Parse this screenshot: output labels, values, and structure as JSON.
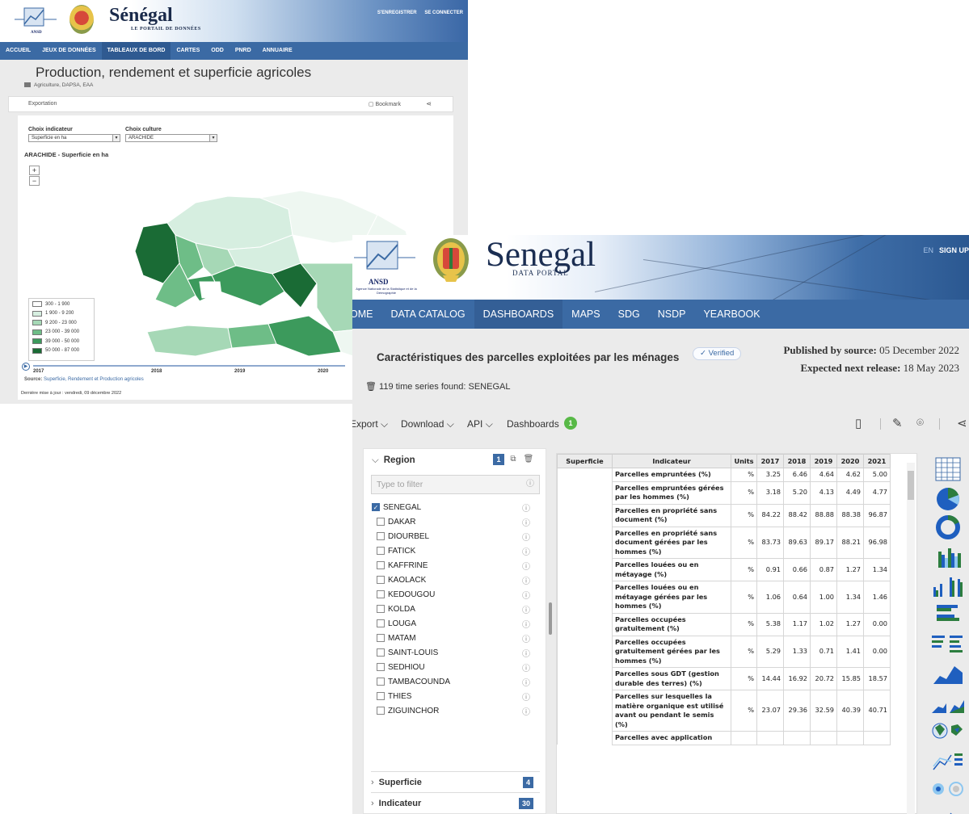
{
  "back_window": {
    "brand": "Sénégal",
    "brand_sub": "LE PORTAIL DE DONNÉES",
    "auth": [
      "S'ENREGISTRER",
      "SE CONNECTER"
    ],
    "nav": [
      "ACCUEIL",
      "JEUX DE DONNÉES",
      "TABLEAUX DE BORD",
      "CARTES",
      "ODD",
      "PNRD",
      "ANNUAIRE"
    ],
    "active_nav": "TABLEAUX DE BORD",
    "title": "Production, rendement et superficie agricoles",
    "breadcrumb": "Agriculture, DAPSA, EAA",
    "export_label": "Exportation",
    "bookmark_label": "Bookmark",
    "indicator_label": "Choix indicateur",
    "indicator_value": "Superficie en ha",
    "culture_label": "Choix culture",
    "culture_value": "ARACHIDE",
    "map_title": "ARACHIDE - Superficie en ha",
    "zoom_in": "+",
    "zoom_out": "−",
    "legend": [
      {
        "label": "300 - 1 900",
        "color": "#ffffff"
      },
      {
        "label": "1 900 - 9 200",
        "color": "#d6eee0"
      },
      {
        "label": "9 200 - 23 000",
        "color": "#a6d8b6"
      },
      {
        "label": "23 000 - 39 000",
        "color": "#6ebd87"
      },
      {
        "label": "39 000 - 50 000",
        "color": "#3c9a5c"
      },
      {
        "label": "50 000 - 87 000",
        "color": "#1a6b35"
      }
    ],
    "timeline_years": [
      "2017",
      "2018",
      "2019",
      "2020"
    ],
    "source_prefix": "Source:",
    "source_link": "Superficie, Rendement et Production agricoles",
    "updated": "Dernière mise à jour : vendredi, 09 décembre 2022"
  },
  "front_window": {
    "ansd": "ANSD",
    "ansd_sub": "Agence Nationale de la Statistique et de la Démographie",
    "brand": "Senegal",
    "brand_sub": "DATA PORTAL",
    "lang": "EN",
    "signup": "SIGN UP",
    "nav": [
      "OME",
      "DATA CATALOG",
      "DASHBOARDS",
      "MAPS",
      "SDG",
      "NSDP",
      "YEARBOOK"
    ],
    "title": "Caractéristiques des parcelles exploitées par les ménages",
    "verified": "✓ Verified",
    "published_label": "Published by source:",
    "published_date": "05 December 2022",
    "next_label": "Expected next release:",
    "next_date": "18 May 2023",
    "found": "119 time series found: SENEGAL",
    "toolbar": {
      "export": "Export",
      "download": "Download",
      "api": "API",
      "dashboards": "Dashboards",
      "dashboards_count": "1"
    },
    "filter": {
      "region_label": "Region",
      "region_count": "1",
      "placeholder": "Type to filter",
      "options": [
        {
          "label": "SENEGAL",
          "checked": true
        },
        {
          "label": "DAKAR",
          "checked": false
        },
        {
          "label": "DIOURBEL",
          "checked": false
        },
        {
          "label": "FATICK",
          "checked": false
        },
        {
          "label": "KAFFRINE",
          "checked": false
        },
        {
          "label": "KAOLACK",
          "checked": false
        },
        {
          "label": "KEDOUGOU",
          "checked": false
        },
        {
          "label": "KOLDA",
          "checked": false
        },
        {
          "label": "LOUGA",
          "checked": false
        },
        {
          "label": "MATAM",
          "checked": false
        },
        {
          "label": "SAINT-LOUIS",
          "checked": false
        },
        {
          "label": "SEDHIOU",
          "checked": false
        },
        {
          "label": "TAMBACOUNDA",
          "checked": false
        },
        {
          "label": "THIES",
          "checked": false
        },
        {
          "label": "ZIGUINCHOR",
          "checked": false
        }
      ],
      "groups": [
        {
          "label": "Superficie",
          "count": "4"
        },
        {
          "label": "Indicateur",
          "count": "30"
        }
      ]
    },
    "table": {
      "headers": [
        "Superficie",
        "Indicateur",
        "Units",
        "2017",
        "2018",
        "2019",
        "2020",
        "2021"
      ],
      "rows": [
        {
          "ind": "Parcelles empruntées (%)",
          "units": "%",
          "values": [
            "3.25",
            "6.46",
            "4.64",
            "4.62",
            "5.00"
          ]
        },
        {
          "ind": "Parcelles empruntées gérées par les hommes (%)",
          "units": "%",
          "values": [
            "3.18",
            "5.20",
            "4.13",
            "4.49",
            "4.77"
          ]
        },
        {
          "ind": "Parcelles en propriété sans document (%)",
          "units": "%",
          "values": [
            "84.22",
            "88.42",
            "88.88",
            "88.38",
            "96.87"
          ]
        },
        {
          "ind": "Parcelles en propriété sans document gérées par les hommes (%)",
          "units": "%",
          "values": [
            "83.73",
            "89.63",
            "89.17",
            "88.21",
            "96.98"
          ]
        },
        {
          "ind": "Parcelles louées ou en métayage (%)",
          "units": "%",
          "values": [
            "0.91",
            "0.66",
            "0.87",
            "1.27",
            "1.34"
          ]
        },
        {
          "ind": "Parcelles louées ou en métayage gérées par les hommes (%)",
          "units": "%",
          "values": [
            "1.06",
            "0.64",
            "1.00",
            "1.34",
            "1.46"
          ]
        },
        {
          "ind": "Parcelles occupées gratuitement (%)",
          "units": "%",
          "values": [
            "5.38",
            "1.17",
            "1.02",
            "1.27",
            "0.00"
          ]
        },
        {
          "ind": "Parcelles occupées gratuitement gérées par les hommes (%)",
          "units": "%",
          "values": [
            "5.29",
            "1.33",
            "0.71",
            "1.41",
            "0.00"
          ]
        },
        {
          "ind": "Parcelles sous GDT (gestion durable des terres) (%)",
          "units": "%",
          "values": [
            "14.44",
            "16.92",
            "20.72",
            "15.85",
            "18.57"
          ]
        },
        {
          "ind": "Parcelles sur lesquelles la matière organique est utilisé avant ou pendant le semis (%)",
          "units": "%",
          "values": [
            "23.07",
            "29.36",
            "32.59",
            "40.39",
            "40.71"
          ]
        },
        {
          "ind": "Parcelles avec application",
          "units": "",
          "values": [
            "",
            "",
            "",
            "",
            ""
          ]
        }
      ]
    },
    "chart_icons": [
      "table-icon",
      "pie-chart-icon",
      "donut-chart-icon",
      "column-chart-icon",
      "multi-column-chart-icon",
      "bar-chart-icon",
      "multi-bar-chart-icon",
      "area-chart-icon",
      "multi-area-chart-icon",
      "map-icon",
      "line-chart-icon",
      "scatter-icon",
      "sparkline-icon"
    ],
    "accent": "#3b6aa4"
  }
}
